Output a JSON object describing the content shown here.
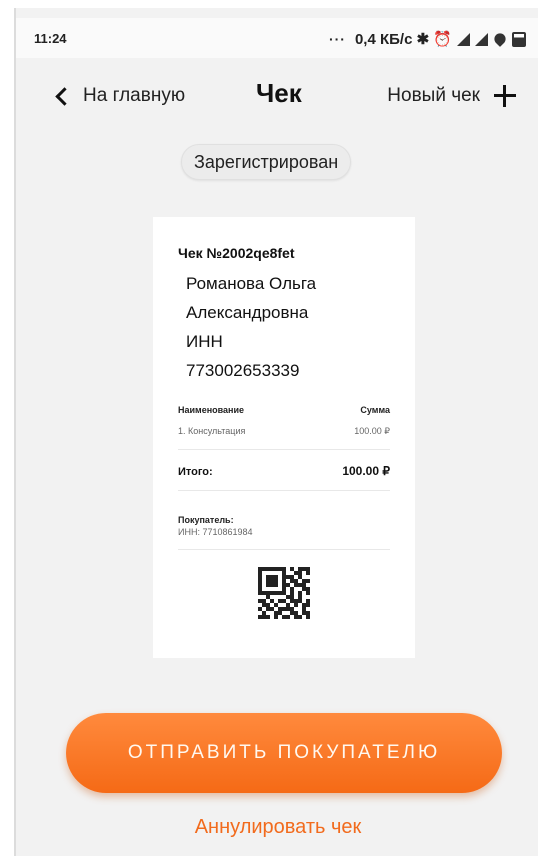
{
  "status_bar": {
    "time": "11:24",
    "dots": "···",
    "network_speed": "0,4 КБ/с ✱ ⏰"
  },
  "header": {
    "back_label": "На главную",
    "title": "Чек",
    "new_label": "Новый чек"
  },
  "status_badge": "Зарегистрирован",
  "receipt": {
    "title": "Чек №2002qe8fet",
    "seller_lines": [
      "Романова Ольга",
      "Александровна",
      "ИНН",
      "773002653339"
    ],
    "table_headers": {
      "name": "Наименование",
      "sum": "Сумма"
    },
    "items": [
      {
        "name": "1.  Консультация",
        "sum": "100.00 ₽"
      }
    ],
    "total_label": "Итого:",
    "total_value": "100.00 ₽",
    "buyer_label": "Покупатель:",
    "buyer_inn": "ИНН: 7710861984"
  },
  "actions": {
    "send_label": "ОТПРАВИТЬ ПОКУПАТЕЛЮ",
    "cancel_label": "Аннулировать чек"
  },
  "colors": {
    "accent": "#f56a16",
    "background": "#f2f2f2"
  },
  "icons": [
    "back-chevron-icon",
    "plus-icon",
    "signal-icon",
    "wifi-icon",
    "battery-icon",
    "qr-code-icon"
  ]
}
